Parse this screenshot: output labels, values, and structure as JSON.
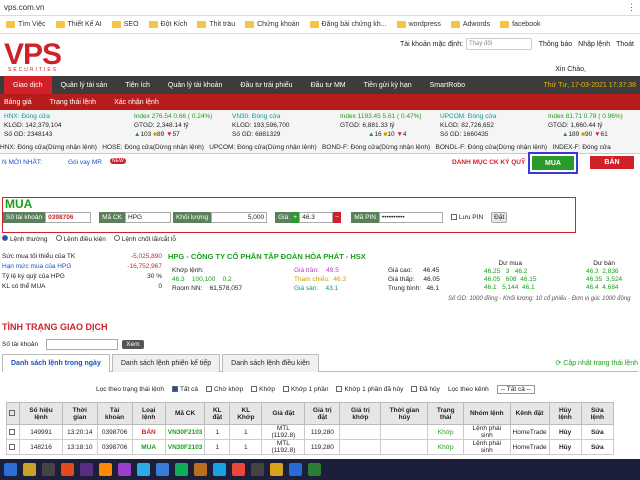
{
  "browser": {
    "url": "vps.com.vn",
    "bookmarks": [
      "Tìm Việc",
      "Thiết Kế AI",
      "SEO",
      "Đột Kích",
      "Thit träu",
      "Chứng khoán",
      "Đăng bài chứng kh...",
      "wordpress",
      "Adwords",
      "facebook"
    ]
  },
  "header": {
    "logo": "VPS",
    "logo_sub": "SECURITIES",
    "account_label": "Tài khoản mặc định:",
    "account_placeholder": "Thay đổi",
    "right_items": [
      "Thông báo",
      "Nhập lệnh",
      "Thoát"
    ],
    "greeting": "Xin Chào,"
  },
  "mainnav": {
    "items": [
      "Giao dịch",
      "Quản lý tài sản",
      "Tiện ích",
      "Quản lý tài khoản",
      "Đầu tư trái phiếu",
      "Đầu tư MM",
      "Tiền gửi kỳ hạn",
      "SmartRobo"
    ],
    "date": "Thứ Tư, 17-03-2021 17:37:38"
  },
  "subnav": {
    "items": [
      "Bảng giá",
      "Trạng thái lệnh",
      "Xác nhận lệnh"
    ]
  },
  "indices": {
    "hnx": {
      "name": "HNX: Đóng cửa",
      "index": "Index 276.54  0.66 ( 0.24%)",
      "klgd": "KLGD:  142,379,104",
      "gtgd": "GTGD:  2,348.14 tỷ",
      "sogd": "Số GD:  2348143",
      "up": "103",
      "ref": "89",
      "down": "57"
    },
    "vn30": {
      "name": "VN30: Đóng cửa",
      "index": "Index 1193.45  5.61 ( 0.47%)",
      "klgd": "KLGD:  193,596,700",
      "gtgd": "GTGD:  6,881.33 tỷ",
      "sogd": "Số GD:  6881329",
      "up": "16",
      "ref": "10",
      "down": "4"
    },
    "upcom": {
      "name": "UPCOM: Đóng cửa",
      "index": "Index 81.71  0.78 ( 0.96%)",
      "klgd": "KLGD:  82,726,652",
      "gtgd": "GTGD:  1,660.44 tỷ",
      "sogd": "Số GD:  1660435",
      "up": "189",
      "ref": "90",
      "down": "61"
    }
  },
  "status_bar": [
    "HNX: Đóng cửa(Dừng nhận lệnh)",
    "HOSE: Đóng cửa(Dừng nhận lệnh)",
    "UPCOM: Đóng cửa(Dừng nhận lệnh)",
    "BOND-F: Đóng cửa(Dừng nhận lệnh)",
    "BONDL-F: Đóng cửa(Dừng nhận lệnh)",
    "INDEX-F: Đóng cửa"
  ],
  "news": {
    "label": "N MỚI NHẤT:",
    "link": "Gói vay MR",
    "badge": "NEW",
    "category_link": "DANH MỤC CK KÝ QUỸ",
    "buy": "MUA",
    "sell": "BÁN"
  },
  "order": {
    "title": "MUA",
    "account_label": "Số tài khoản",
    "account_value": "0398706",
    "code_label": "Mã CK",
    "code_value": "HPG",
    "qty_label": "Khối lượng",
    "qty_value": "5,000",
    "price_label": "Giá",
    "price_value": "46.3",
    "pin_label": "Mã PIN",
    "pin_value": "••••••••••",
    "save_pin": "Lưu PIN",
    "submit": "Đặt"
  },
  "order_types": [
    "Lệnh thường",
    "Lệnh điều kiện",
    "Lệnh chốt lãi/cắt lỗ"
  ],
  "left_panel": [
    [
      "Sức mua tối thiểu của TK",
      "-5,025,890"
    ],
    [
      "Hạn mức mua của HPG",
      "-16,752,967"
    ],
    [
      "Tỷ lệ ký quỹ của HPG",
      "30 %"
    ],
    [
      "KL có thể MUA",
      "0"
    ]
  ],
  "stock": {
    "title": "HPG - CÔNG TY CỔ PHẦN TẬP ĐOÀN HÒA PHÁT - HSX",
    "room_label": "Khớp lệnh:",
    "match": [
      "46.3",
      "100,100",
      "0.2"
    ],
    "room_nn": "Room NN:",
    "room_val": "61,578,057",
    "ceiling": "Giá trần:",
    "ceiling_v": "49.5",
    "ref": "Tham chiếu:",
    "ref_v": "46.3",
    "floor": "Giá sàn:",
    "floor_v": "43.1",
    "high": "Giá cao:",
    "high_v": "46.45",
    "low": "Giá thấp:",
    "low_v": "46.05",
    "avg": "Trung bình:",
    "avg_v": "46.1",
    "buy_head": "Dư mua",
    "sell_head": "Dư bán",
    "buys": [
      [
        "46.25",
        "3",
        "46.2"
      ],
      [
        "46.05",
        "608",
        "46.15"
      ],
      [
        "46.1",
        "5,144",
        "46.1"
      ]
    ],
    "sells": [
      [
        "46.3",
        "2,836"
      ],
      [
        "46.35",
        "3,524"
      ],
      [
        "46.4",
        "4,684"
      ]
    ],
    "note": "Số GD: 1000 đồng - Khối lượng: 10 cổ phiếu - Đơn vị giá: 1000 đồng"
  },
  "trade_status": {
    "title": "TÌNH TRẠNG GIAO DỊCH",
    "account_label": "Số tài khoản",
    "view": "Xem",
    "tabs": [
      "Danh sách lệnh trong ngày",
      "Danh sách lệnh phiên kế tiếp",
      "Danh sách lệnh điều kiện"
    ],
    "update_link": "Cập nhật trạng thái lệnh",
    "filter_label": "Lọc theo trạng thái lệnh",
    "filters": [
      "Tất cả",
      "Chờ khớp",
      "Khớp",
      "Khớp 1 phần",
      "Khớp 1 phần đã hủy",
      "Đã hủy"
    ],
    "filter_type_label": "Lọc theo kênh",
    "filter_type_value": "-- Tất cả --"
  },
  "table": {
    "headers": [
      "",
      "Số hiệu lệnh",
      "Thời gian",
      "Tài khoản",
      "Loại lệnh",
      "Mã CK",
      "KL đặt",
      "KL Khớp",
      "Giá đặt",
      "Giá trị đặt",
      "Giá trị khớp",
      "Thời gian hủy",
      "Trạng thái",
      "Nhóm lệnh",
      "Kênh đặt",
      "Hủy lệnh",
      "Sửa lệnh"
    ],
    "rows": [
      [
        "",
        "149991",
        "13:20:14",
        "0398706",
        "BÁN",
        "VN30F2103",
        "1",
        "1",
        "MTL (1192.8)",
        "119,280",
        "",
        "",
        "Khớp",
        "Lệnh phái sinh",
        "HomeTrade",
        "Hủy",
        "Sửa"
      ],
      [
        "",
        "148216",
        "13:18:10",
        "0398706",
        "MUA",
        "VN30F2103",
        "1",
        "1",
        "MTL (1192.8)",
        "119,280",
        "",
        "",
        "Khớp",
        "Lệnh phái sinh",
        "HomeTrade",
        "Hủy",
        "Sửa"
      ]
    ]
  }
}
